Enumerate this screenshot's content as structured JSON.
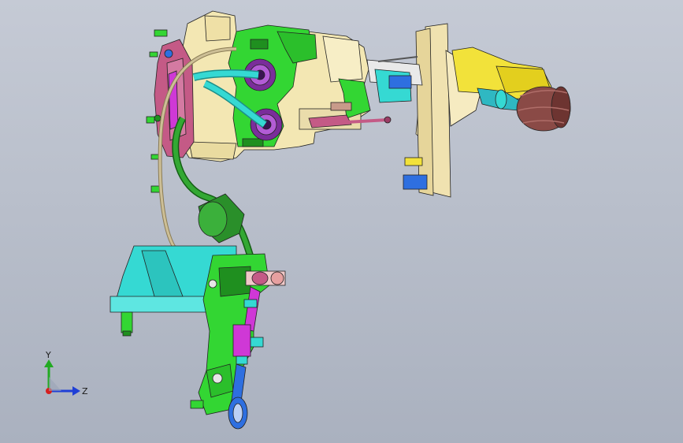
{
  "viewport": {
    "model_name": "gear-shifter-assembly",
    "background": [
      "#c5cad5",
      "#aab1bf"
    ]
  },
  "triad": {
    "y_label": "Y",
    "z_label": "Z",
    "y_color": "#22aa22",
    "z_color": "#1f3fd6",
    "x_color": "#d61f1f"
  },
  "palette": {
    "housing": "#f3e7b3",
    "bracket_green": "#33d633",
    "dark_green": "#1f8f1f",
    "cyan_base": "#35d9d3",
    "magenta": "#cf38d6",
    "purple_bushing": "#7a2d9a",
    "knob": "#8a4a46",
    "yellow": "#f2e23a",
    "blue_link": "#2e6fe0",
    "pink_plate": "#c45a86",
    "boot_tan": "#cdbf96"
  }
}
